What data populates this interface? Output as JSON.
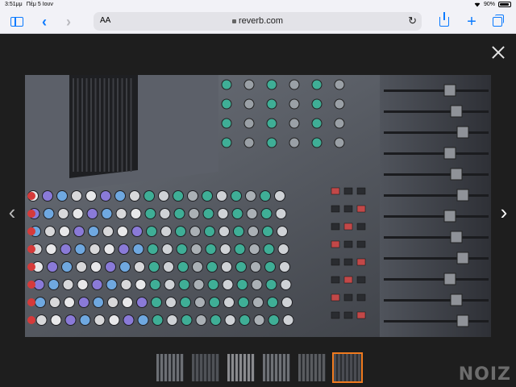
{
  "status_bar": {
    "time": "3:51μμ",
    "date": "Πέμ 5 Ιουν",
    "battery": "90%",
    "battery_level": 0.9
  },
  "toolbar": {
    "reader_label": "AA",
    "url": "reverb.com"
  },
  "lightbox": {
    "thumbnails": [
      {
        "tone": "#6c6f74",
        "active": false
      },
      {
        "tone": "#4f5257",
        "active": false
      },
      {
        "tone": "#8a8b8e",
        "active": false
      },
      {
        "tone": "#6e7176",
        "active": false
      },
      {
        "tone": "#5a5c60",
        "active": false
      },
      {
        "tone": "#4a4c52",
        "active": true
      }
    ],
    "watermark": "NOIZ"
  },
  "colors": {
    "accent": "#0a7aff",
    "active_thumb_border": "#f07a1e",
    "lightbox_bg": "#1e1e1e"
  }
}
